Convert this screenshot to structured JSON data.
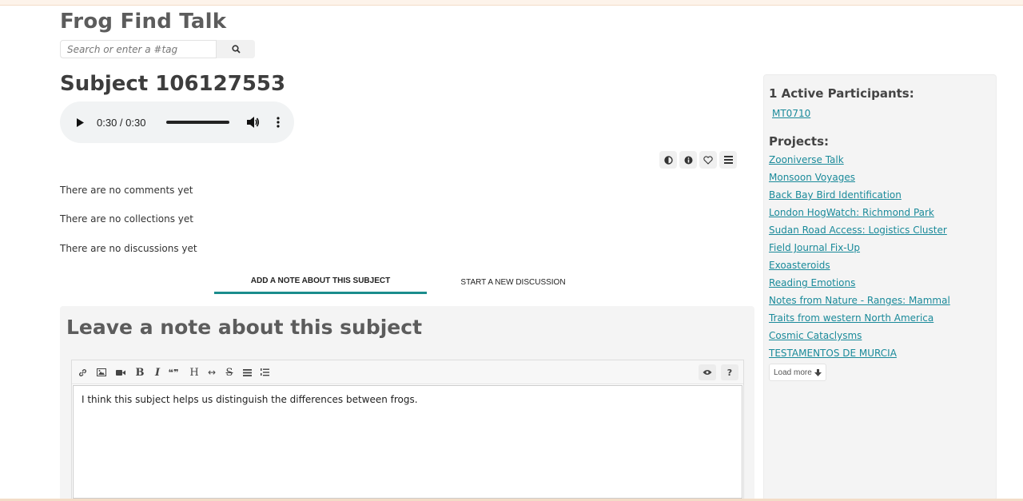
{
  "site": {
    "title": "Frog Find Talk"
  },
  "search": {
    "placeholder": "Search or enter a #tag"
  },
  "subject": {
    "title": "Subject 106127553"
  },
  "audio": {
    "time": "0:30 / 0:30",
    "progress": 1.0
  },
  "toolicons": [
    "contrast-icon",
    "info-icon",
    "heart-icon",
    "list-icon"
  ],
  "messages": {
    "comments": "There are no comments yet",
    "collections": "There are no collections yet",
    "discussions": "There are no discussions yet"
  },
  "tabs": [
    {
      "label": "ADD A NOTE ABOUT THIS SUBJECT",
      "active": true
    },
    {
      "label": "START A NEW DISCUSSION",
      "active": false
    }
  ],
  "note": {
    "title": "Leave a note about this subject",
    "body": "I think this subject helps us distinguish the differences between frogs.",
    "toolbar": [
      "link-icon",
      "image-icon",
      "video-icon",
      "bold-icon",
      "italic-icon",
      "quote-icon",
      "heading-icon",
      "hr-icon",
      "strikethrough-icon",
      "bullet-list-icon",
      "numbered-list-icon",
      "preview-icon",
      "help-icon"
    ]
  },
  "sidebar": {
    "participants_heading": "1 Active Participants:",
    "participants": [
      "MT0710"
    ],
    "projects_heading": "Projects:",
    "projects": [
      "Zooniverse Talk",
      "Monsoon Voyages",
      "Back Bay Bird Identification",
      "London HogWatch: Richmond Park ",
      "Sudan Road Access: Logistics Cluster",
      "Field Journal Fix-Up",
      "Exoasteroids",
      "Reading Emotions",
      "Notes from Nature - Ranges: Mammal ",
      "Traits from western North America",
      "Cosmic Cataclysms ",
      "TESTAMENTOS DE MURCIA"
    ],
    "load_more": "Load more"
  },
  "colors": {
    "accent": "#1b8c8c",
    "link": "#1a8a9a"
  }
}
